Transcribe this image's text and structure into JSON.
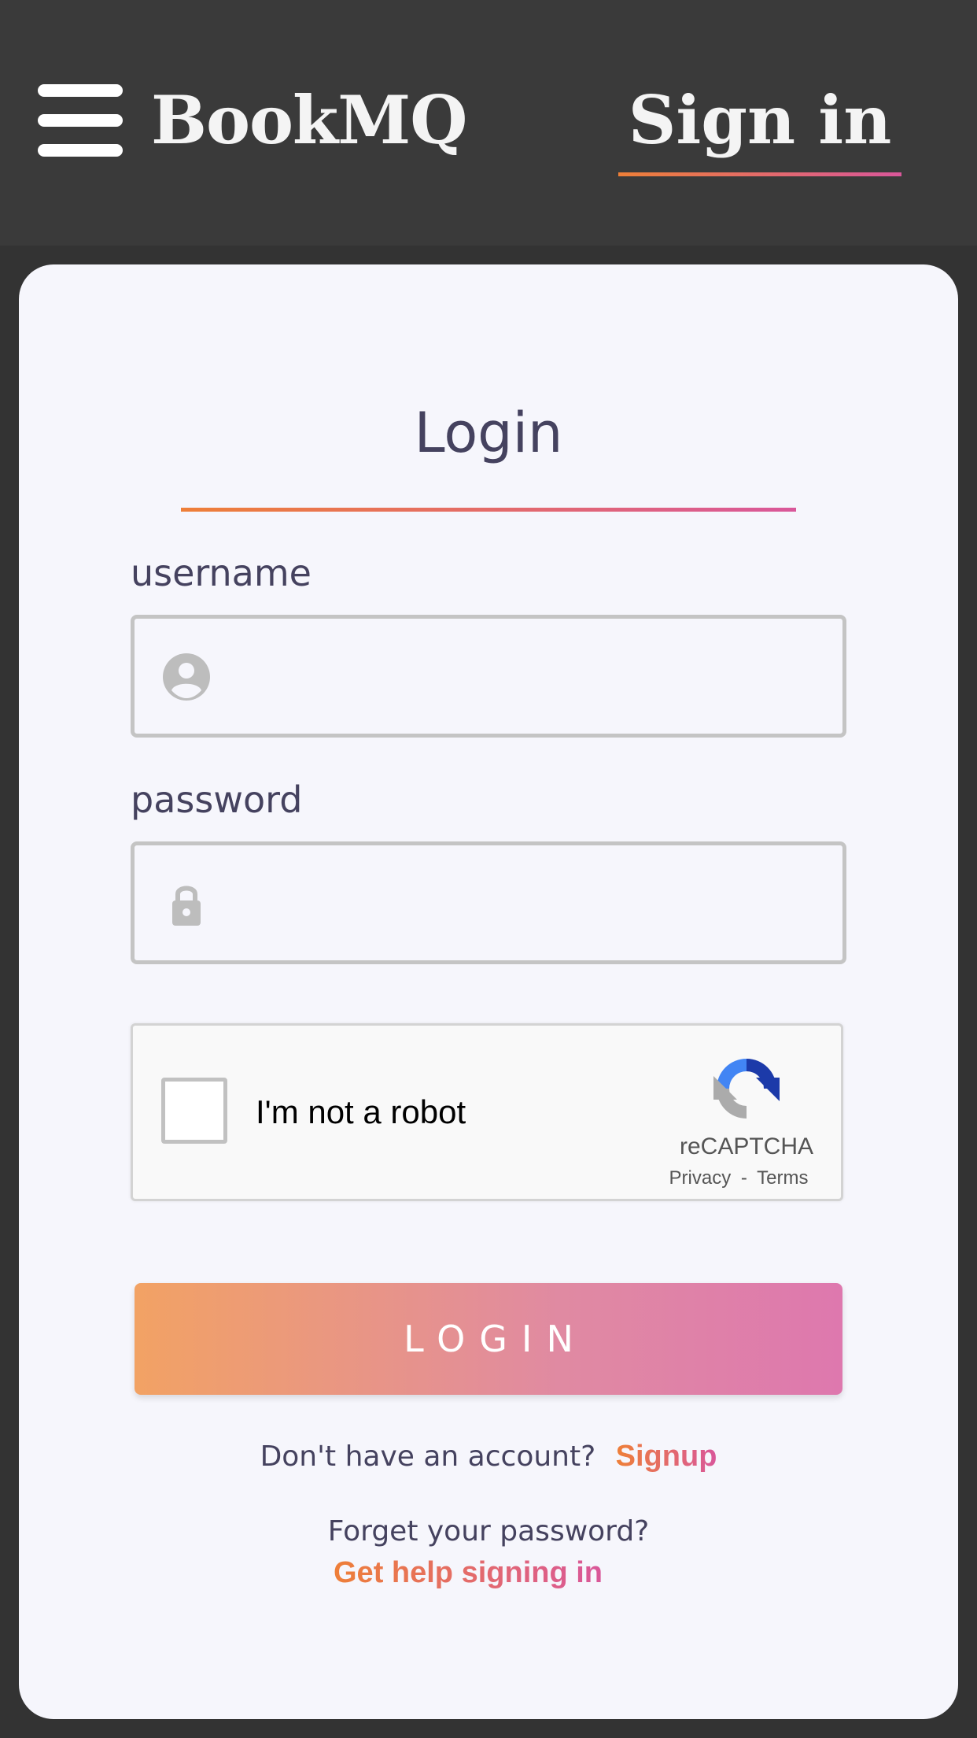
{
  "header": {
    "brand": "BookMQ",
    "nav_signin": "Sign in",
    "menu_icon": "hamburger-menu-icon",
    "accent_start": "#ee7f38",
    "accent_end": "#d9579a"
  },
  "form": {
    "title": "Login",
    "username": {
      "label": "username",
      "value": "",
      "icon": "user-circle-icon"
    },
    "password": {
      "label": "password",
      "value": "",
      "icon": "lock-icon"
    },
    "captcha": {
      "label": "I'm not a robot",
      "brand": "reCAPTCHA",
      "privacy": "Privacy",
      "separator": "-",
      "terms": "Terms",
      "checked": false
    },
    "submit_label": "LOGIN",
    "signup_prompt": "Don't have an account?",
    "signup_link": "Signup",
    "forgot_prompt": "Forget your password?",
    "help_link": "Get help signing in"
  },
  "colors": {
    "header_bg": "#3a3a3a",
    "card_bg": "#f6f6fc",
    "text_primary": "#45425f",
    "button_start": "#f2a264",
    "button_end": "#de78ae"
  }
}
